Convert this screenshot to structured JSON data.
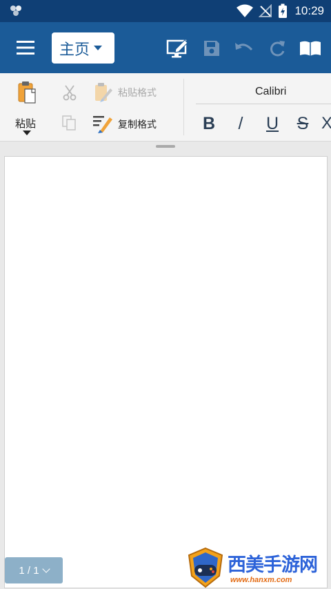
{
  "status_bar": {
    "time": "10:29"
  },
  "app_bar": {
    "tab_label": "主页"
  },
  "ribbon": {
    "paste_label": "粘贴",
    "paste_format_label": "粘贴格式",
    "copy_format_label": "复制格式",
    "font_name": "Calibri",
    "bold": "B",
    "italic": "/",
    "underline": "U",
    "strike": "S",
    "more": "X"
  },
  "document": {
    "page_indicator": "1 / 1"
  },
  "watermark": {
    "title": "西美手游网",
    "url": "www.hanxm.com"
  }
}
